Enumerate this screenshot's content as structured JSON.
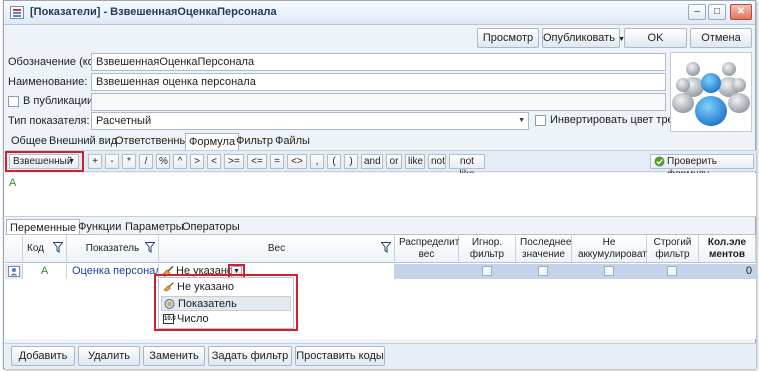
{
  "window": {
    "title": "[Показатели] - ВзвешеннаяОценкаПерсонала"
  },
  "header_buttons": {
    "preview": "Просмотр",
    "publish": "Опубликовать",
    "ok": "OK",
    "cancel": "Отмена"
  },
  "form": {
    "code_label": "Обозначение (код):",
    "code_value": "ВзвешеннаяОценкаПерсонала",
    "name_label": "Наименование:",
    "name_value": "Взвешенная оценка персонала",
    "in_publication_label": "В публикации:",
    "in_publication_value": "",
    "type_label": "Тип показателя:",
    "type_value": "Расчетный",
    "invert_color_label": "Инвертировать цвет тренда"
  },
  "main_tabs": [
    "Общее",
    "Внешний вид",
    "Ответственные",
    "Формула",
    "Фильтр",
    "Файлы"
  ],
  "main_tab_active": "Формула",
  "formula_toolbar": {
    "mode": "Взвешенный",
    "operators": [
      "+",
      "-",
      "*",
      "/",
      "%",
      "^",
      ">",
      "<",
      ">=",
      "<=",
      "=",
      "<>",
      ",",
      "(",
      ")",
      "and",
      "or",
      "like",
      "not",
      "not like"
    ],
    "check_label": "Проверить формулу"
  },
  "formula_text": "A",
  "sub_tabs": [
    "Переменные",
    "Функции",
    "Параметры",
    "Операторы"
  ],
  "sub_tab_active": "Переменные",
  "grid": {
    "columns": [
      "Код",
      "Показатель",
      "Вес",
      "Распределить вес",
      "Игнор. фильтр",
      "Последнее значение",
      "Не аккумулировать",
      "Строгий фильтр",
      "Кол.эле ментов"
    ],
    "rows": [
      {
        "code": "A",
        "indicator": "Оценка персонала",
        "weight": "Не указано",
        "count": "0"
      }
    ]
  },
  "weight_dropdown": {
    "options": [
      "Не указано",
      "Показатель",
      "Число"
    ],
    "number_icon_text": "10.0"
  },
  "bottom_buttons": {
    "add": "Добавить",
    "delete": "Удалить",
    "replace": "Заменить",
    "set_filter": "Задать фильтр",
    "insert_codes": "Проставить коды"
  },
  "colors": {
    "highlight_border": "#d0202a",
    "link_text": "#1c3fa0",
    "formula_text": "#2f8f2f",
    "selection": "#c3d4ea"
  }
}
